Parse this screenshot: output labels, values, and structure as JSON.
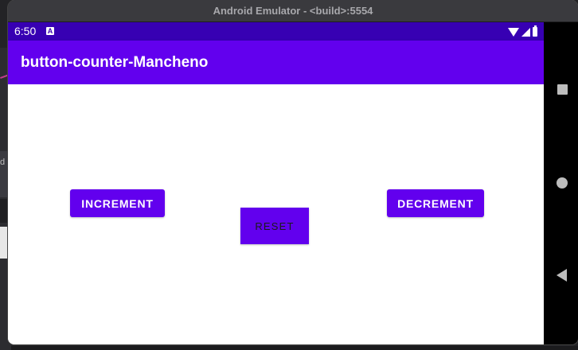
{
  "window": {
    "title": "Android Emulator - <build>:5554"
  },
  "host": {
    "strip_text": "d"
  },
  "status_bar": {
    "time": "6:50",
    "notification_icon": "a-notification-icon",
    "icons": [
      "wifi-icon",
      "signal-icon",
      "battery-icon"
    ]
  },
  "app_bar": {
    "title": "button-counter-Mancheno"
  },
  "buttons": {
    "increment": "INCREMENT",
    "reset": "RESET",
    "decrement": "DECREMENT"
  },
  "nav": {
    "items": [
      "recents-square-icon",
      "home-circle-icon",
      "back-triangle-icon"
    ]
  },
  "colors": {
    "status_bar": "#3700b3",
    "app_bar": "#6200ee",
    "button": "#6200ee"
  }
}
